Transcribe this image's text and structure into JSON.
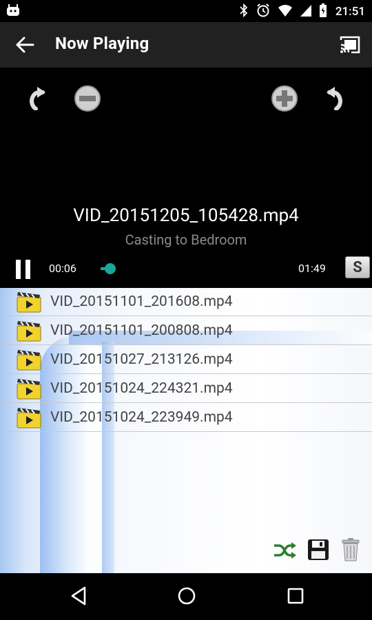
{
  "status": {
    "time": "21:51"
  },
  "appbar": {
    "title": "Now Playing"
  },
  "player": {
    "title": "VID_20151205_105428.mp4",
    "subtitle": "Casting to Bedroom",
    "elapsed": "00:06",
    "duration": "01:49",
    "progress": 0.05,
    "s_label": "S"
  },
  "playlist": [
    {
      "name": "VID_20151101_201608.mp4"
    },
    {
      "name": "VID_20151101_200808.mp4"
    },
    {
      "name": "VID_20151027_213126.mp4"
    },
    {
      "name": "VID_20151024_224321.mp4"
    },
    {
      "name": "VID_20151024_223949.mp4"
    }
  ],
  "colors": {
    "accent": "#1aa69b",
    "appbar": "#212121",
    "clip_icon": "#f2d22e"
  }
}
